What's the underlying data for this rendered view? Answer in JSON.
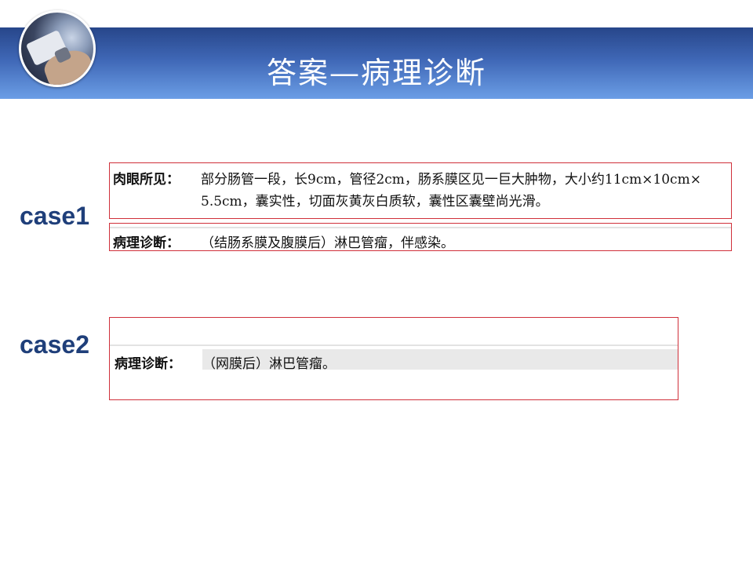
{
  "header": {
    "title": "答案—病理诊断"
  },
  "case1": {
    "label": "case1",
    "gross": {
      "key": "肉眼所见：",
      "line1": "部分肠管一段，长9cm，管径2cm，肠系膜区见一巨大肿物，大小约11cm×10cm×",
      "line2": "5.5cm，囊实性，切面灰黄灰白质软，囊性区囊壁尚光滑。"
    },
    "diagnosis": {
      "key": "病理诊断：",
      "value": "（结肠系膜及腹膜后）淋巴管瘤，伴感染。"
    }
  },
  "case2": {
    "label": "case2",
    "diagnosis": {
      "key": "病理诊断：",
      "value": "（网膜后）淋巴管瘤。"
    }
  },
  "colors": {
    "header_dark": "#27468a",
    "header_light": "#6b9ee6",
    "case_label": "#1f3f7a",
    "box_border": "#d0303a"
  }
}
